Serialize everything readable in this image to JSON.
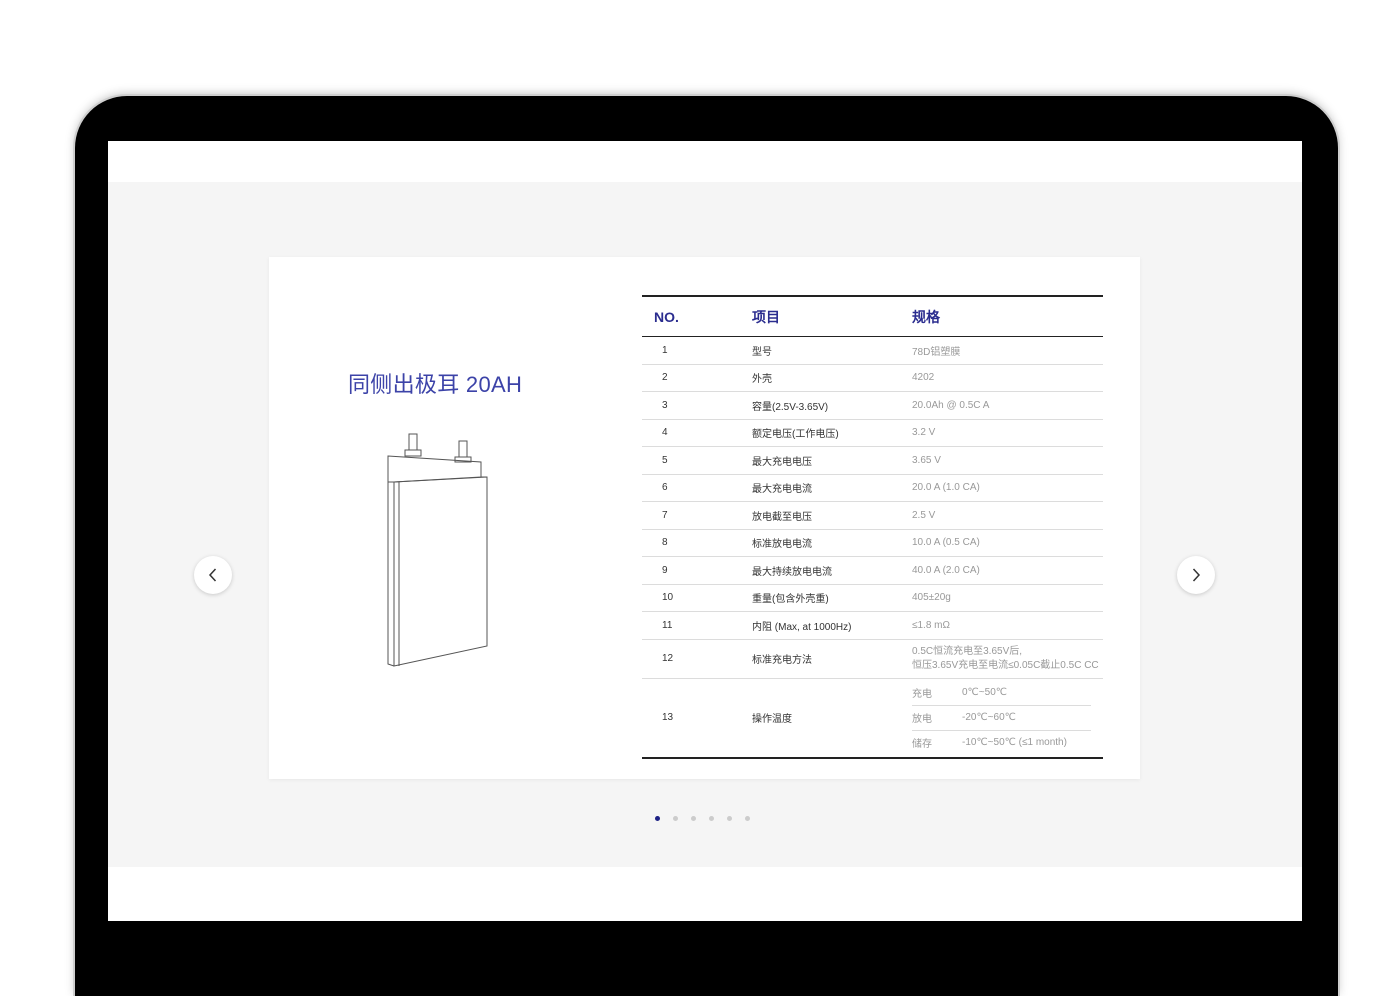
{
  "product": {
    "title": "同侧出极耳 20AH"
  },
  "table": {
    "headers": {
      "no": "NO.",
      "item": "项目",
      "spec": "规格"
    },
    "rows": [
      {
        "no": "1",
        "item": "型号",
        "spec": "78D铝塑膜"
      },
      {
        "no": "2",
        "item": "外壳",
        "spec": "4202"
      },
      {
        "no": "3",
        "item": "容量(2.5V-3.65V)",
        "spec": "20.0Ah @ 0.5C A"
      },
      {
        "no": "4",
        "item": "额定电压(工作电压)",
        "spec": "3.2 V"
      },
      {
        "no": "5",
        "item": "最大充电电压",
        "spec": "3.65 V"
      },
      {
        "no": "6",
        "item": "最大充电电流",
        "spec": "20.0 A (1.0 CA)"
      },
      {
        "no": "7",
        "item": "放电截至电压",
        "spec": "2.5 V"
      },
      {
        "no": "8",
        "item": "标准放电电流",
        "spec": "10.0 A (0.5 CA)"
      },
      {
        "no": "9",
        "item": "最大持续放电电流",
        "spec": "40.0 A (2.0 CA)"
      },
      {
        "no": "10",
        "item": "重量(包含外壳重)",
        "spec": "405±20g"
      },
      {
        "no": "11",
        "item": "内阻 (Max, at 1000Hz)",
        "spec": "≤1.8 mΩ"
      }
    ],
    "row12": {
      "no": "12",
      "item": "标准充电方法",
      "spec_line1": "0.5C恒流充电至3.65V后,",
      "spec_line2": "恒压3.65V充电至电流≤0.05C截止0.5C CC"
    },
    "row13": {
      "no": "13",
      "item": "操作温度",
      "temps": [
        {
          "label": "充电",
          "value": "0℃~50℃"
        },
        {
          "label": "放电",
          "value": "-20℃~60℃"
        },
        {
          "label": "储存",
          "value": "-10℃~50℃ (≤1 month)"
        }
      ]
    }
  },
  "carousel": {
    "prev_icon": "chevron-left-icon",
    "next_icon": "chevron-right-icon",
    "active_index": 0,
    "total": 6
  },
  "colors": {
    "accent": "#2b2d8f",
    "title": "#3c43a8",
    "dot_active": "#1d2185",
    "section_bg": "#f5f5f5"
  }
}
